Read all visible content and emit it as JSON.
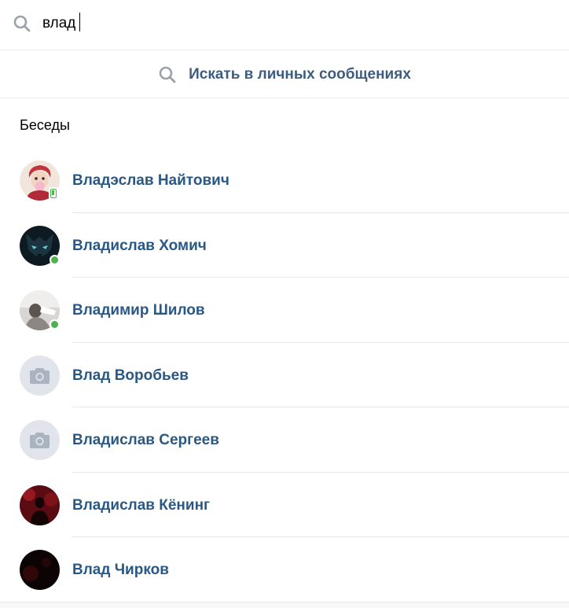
{
  "search": {
    "value": "влад",
    "icon": "search-icon"
  },
  "search_dm": {
    "label": "Искать в личных сообщениях",
    "icon": "search-icon"
  },
  "section": {
    "title": "Беседы"
  },
  "colors": {
    "link": "#2a5885",
    "accent": "#3c5d80",
    "online": "#4bb34b",
    "divider": "#e7e8ec",
    "placeholder": "#e1e5eb"
  },
  "contacts": [
    {
      "name": "Владэслав Найтович",
      "status": "mobile",
      "avatar": "photo"
    },
    {
      "name": "Владислав Хомич",
      "status": "online",
      "avatar": "photo"
    },
    {
      "name": "Владимир Шилов",
      "status": "online",
      "avatar": "photo"
    },
    {
      "name": "Влад Воробьев",
      "status": "",
      "avatar": "camera-icon"
    },
    {
      "name": "Владислав Сергеев",
      "status": "",
      "avatar": "camera-icon"
    },
    {
      "name": "Владислав Кёнинг",
      "status": "",
      "avatar": "photo"
    },
    {
      "name": "Влад Чирков",
      "status": "",
      "avatar": "photo"
    }
  ]
}
